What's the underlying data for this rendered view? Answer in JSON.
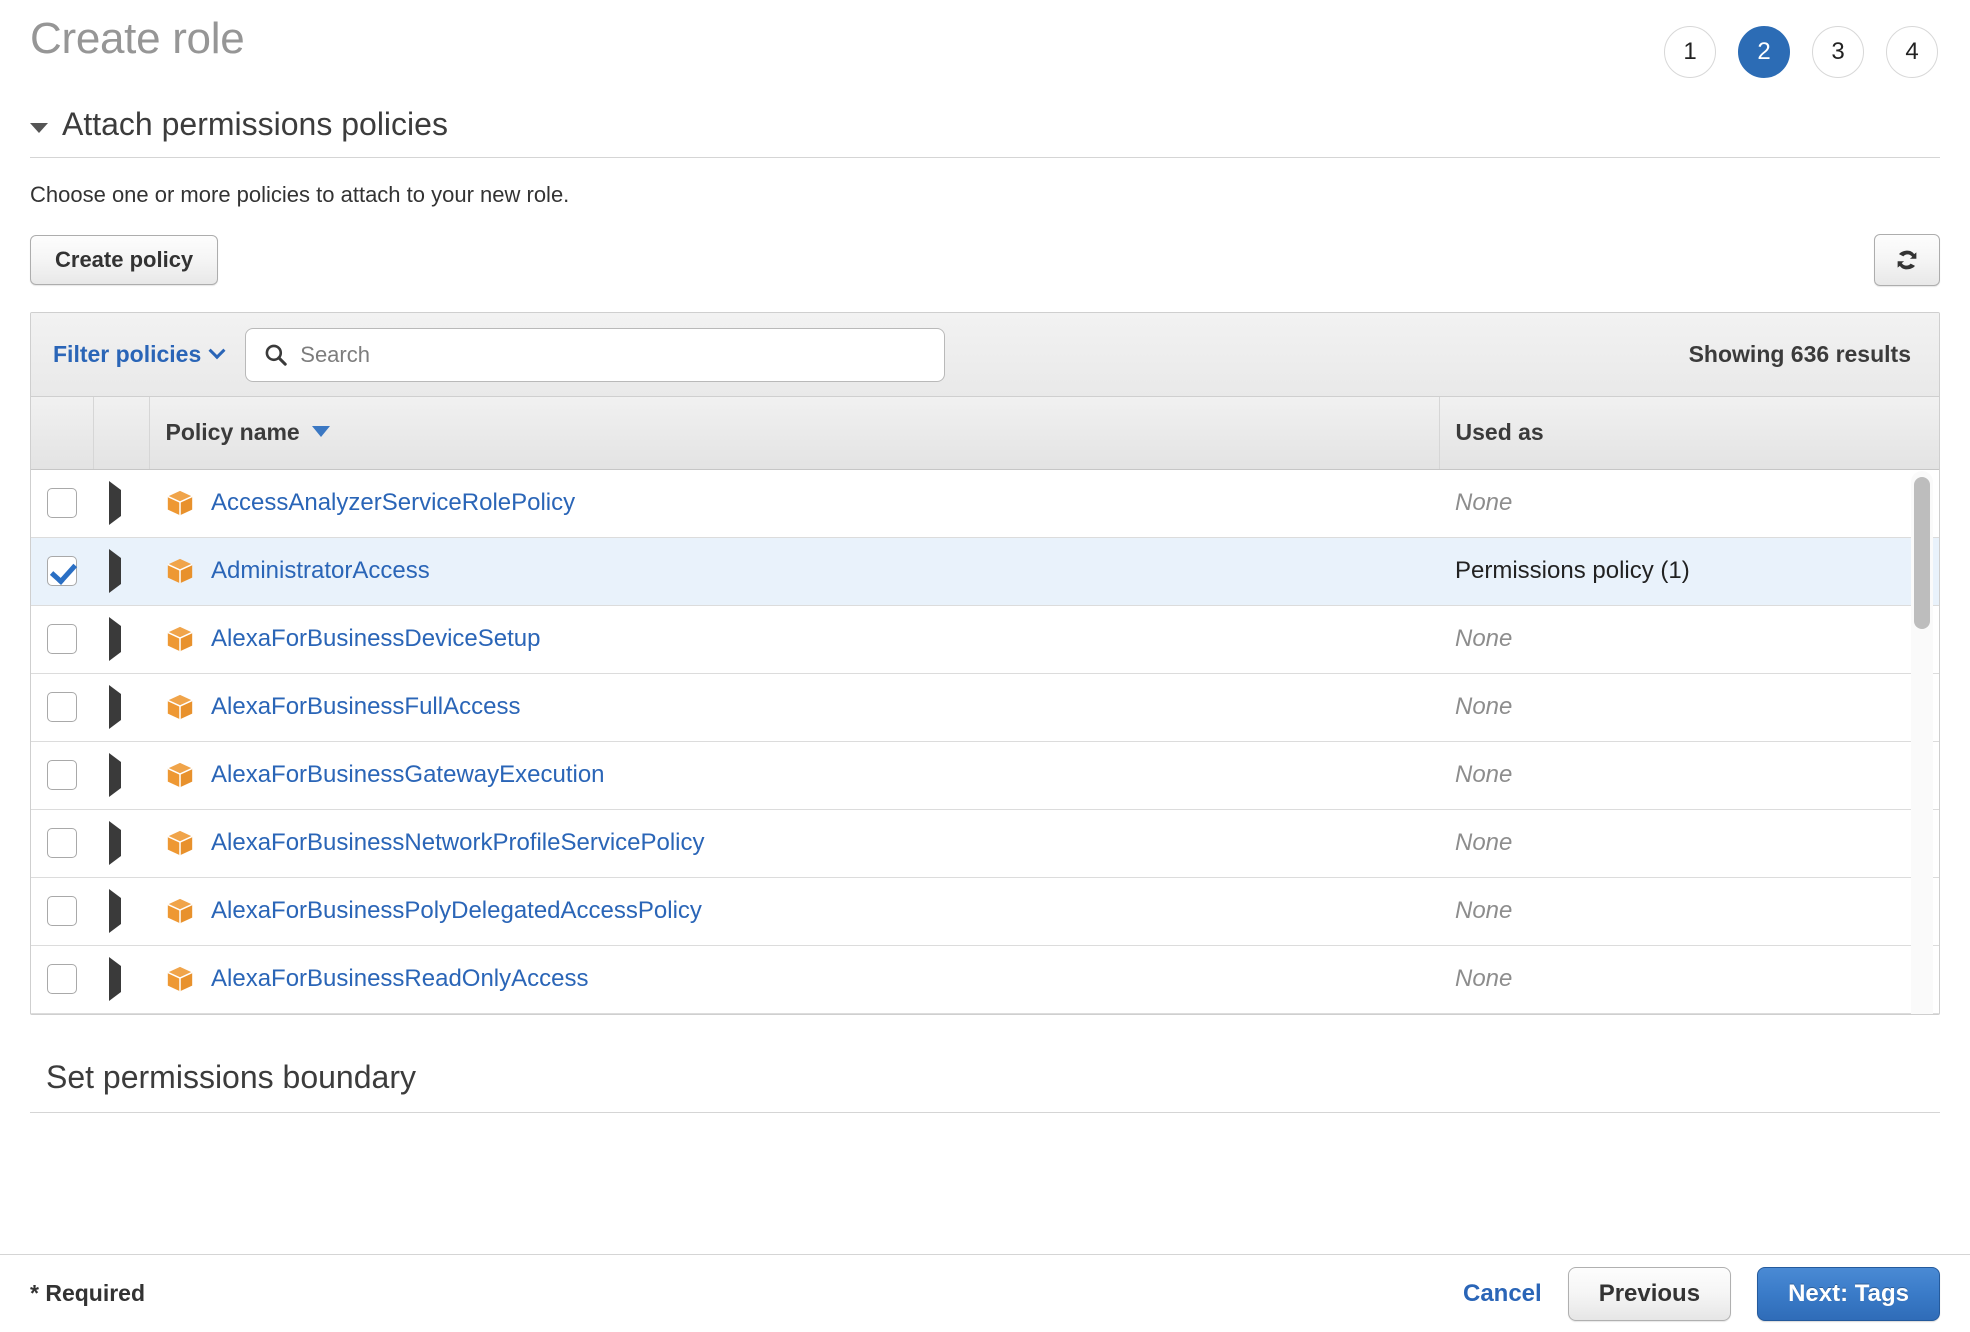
{
  "header": {
    "title": "Create role",
    "steps": [
      {
        "label": "1",
        "active": false
      },
      {
        "label": "2",
        "active": true
      },
      {
        "label": "3",
        "active": false
      },
      {
        "label": "4",
        "active": false
      }
    ]
  },
  "permissions_section": {
    "title": "Attach permissions policies",
    "description": "Choose one or more policies to attach to your new role.",
    "expanded": true
  },
  "toolbar": {
    "create_policy_label": "Create policy",
    "refresh_icon": "refresh-icon"
  },
  "filter_bar": {
    "filter_label": "Filter policies",
    "search_placeholder": "Search",
    "search_value": "",
    "search_icon": "search-icon",
    "results_text": "Showing 636 results"
  },
  "table": {
    "columns": {
      "checkbox": "",
      "expand": "",
      "policy_name": "Policy name",
      "used_as": "Used as"
    },
    "sort_column": "Policy name",
    "sort_direction": "descending",
    "rows": [
      {
        "checked": false,
        "icon": "policy-cube-icon",
        "name": "AccessAnalyzerServiceRolePolicy",
        "used_as": "None",
        "used_as_none": true
      },
      {
        "checked": true,
        "icon": "policy-cube-icon",
        "name": "AdministratorAccess",
        "used_as": "Permissions policy (1)",
        "used_as_none": false
      },
      {
        "checked": false,
        "icon": "policy-cube-icon",
        "name": "AlexaForBusinessDeviceSetup",
        "used_as": "None",
        "used_as_none": true
      },
      {
        "checked": false,
        "icon": "policy-cube-icon",
        "name": "AlexaForBusinessFullAccess",
        "used_as": "None",
        "used_as_none": true
      },
      {
        "checked": false,
        "icon": "policy-cube-icon",
        "name": "AlexaForBusinessGatewayExecution",
        "used_as": "None",
        "used_as_none": true
      },
      {
        "checked": false,
        "icon": "policy-cube-icon",
        "name": "AlexaForBusinessNetworkProfileServicePolicy",
        "used_as": "None",
        "used_as_none": true
      },
      {
        "checked": false,
        "icon": "policy-cube-icon",
        "name": "AlexaForBusinessPolyDelegatedAccessPolicy",
        "used_as": "None",
        "used_as_none": true
      },
      {
        "checked": false,
        "icon": "policy-cube-icon",
        "name": "AlexaForBusinessReadOnlyAccess",
        "used_as": "None",
        "used_as_none": true
      }
    ]
  },
  "boundary_section": {
    "title": "Set permissions boundary",
    "expanded": false
  },
  "footer": {
    "required_note": "* Required",
    "cancel_label": "Cancel",
    "previous_label": "Previous",
    "next_label": "Next: Tags"
  },
  "colors": {
    "accent_blue": "#2a65b7",
    "step_active": "#2c6cb5",
    "policy_icon_orange": "#ef9a3a",
    "selected_row": "#e9f2fb"
  }
}
